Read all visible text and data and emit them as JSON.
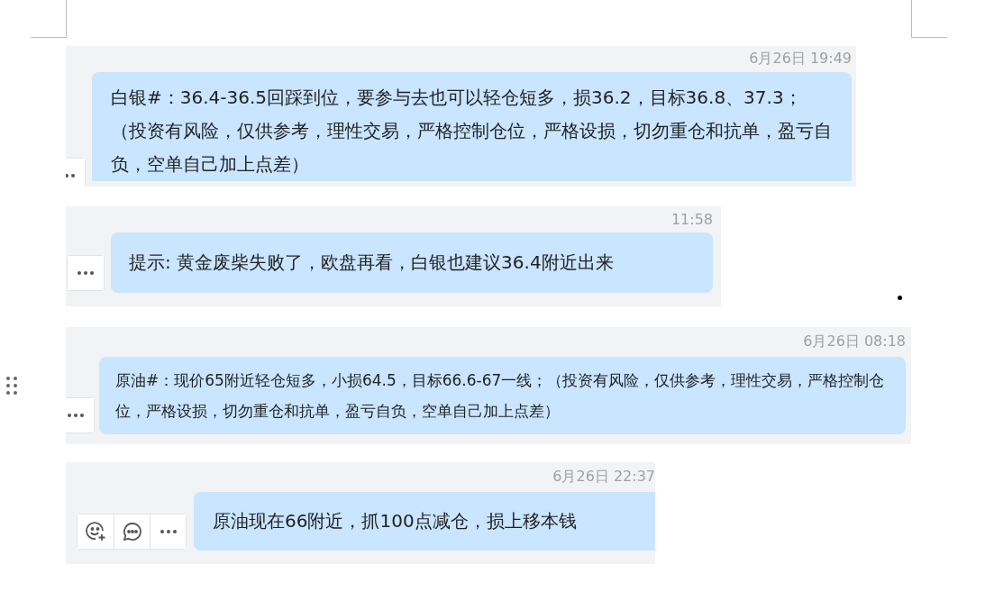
{
  "messages": [
    {
      "time": "6月26日 19:49",
      "text": "白银#：36.4-36.5回踩到位，要参与去也可以轻仓短多，损36.2，目标36.8、37.3；（投资有风险，仅供参考，理性交易，严格控制仓位，严格设损，切勿重仓和抗单，盈亏自负，空单自己加上点差）",
      "actions": [
        {
          "kind": "more"
        }
      ]
    },
    {
      "time": "11:58",
      "text": "提示: 黄金废柴失败了，欧盘再看，白银也建议36.4附近出来",
      "actions": [
        {
          "kind": "more"
        }
      ]
    },
    {
      "time": "6月26日 08:18",
      "text": "原油#：现价65附近轻仓短多，小损64.5，目标66.6-67一线；（投资有风险，仅供参考，理性交易，严格控制仓位，严格设损，切勿重仓和抗单，盈亏自负，空单自己加上点差）",
      "actions": [
        {
          "kind": "more"
        }
      ]
    },
    {
      "time": "6月26日 22:37",
      "text": "原油现在66附近，抓100点减仓，损上移本钱",
      "actions": [
        {
          "kind": "react"
        },
        {
          "kind": "reply"
        },
        {
          "kind": "more"
        }
      ]
    }
  ]
}
